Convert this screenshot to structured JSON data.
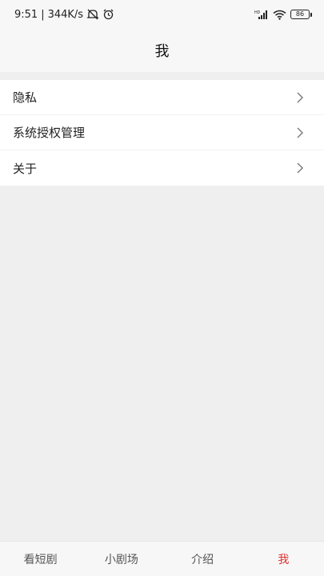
{
  "status_bar": {
    "time": "9:51",
    "separator": "|",
    "network_speed": "344K/s",
    "battery_level": "86",
    "icons": [
      "mute-icon",
      "alarm-icon",
      "hd-signal-icon",
      "wifi-icon",
      "battery-icon"
    ]
  },
  "header": {
    "title": "我"
  },
  "menu": {
    "items": [
      {
        "label": "隐私",
        "icon": "chevron-right-icon"
      },
      {
        "label": "系统授权管理",
        "icon": "chevron-right-icon"
      },
      {
        "label": "关于",
        "icon": "chevron-right-icon"
      }
    ]
  },
  "tabbar": {
    "active_color": "#e0312f",
    "tabs": [
      {
        "label": "看短剧"
      },
      {
        "label": "小剧场"
      },
      {
        "label": "介绍"
      },
      {
        "label": "我"
      }
    ]
  }
}
